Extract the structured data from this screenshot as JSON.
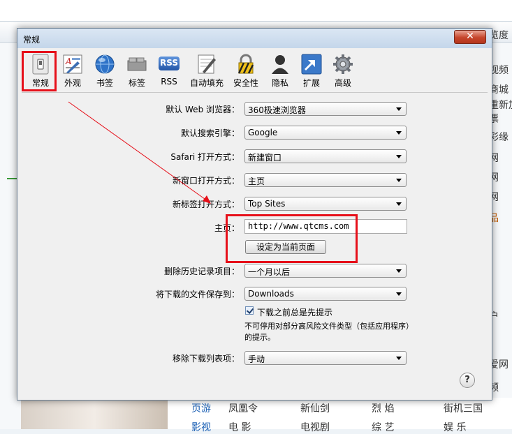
{
  "background": {
    "side_items": [
      "览度",
      "视频",
      "商城",
      "重新加",
      "票",
      "彩缘",
      "网",
      "网",
      "网",
      "品",
      "户",
      "爱网",
      "频"
    ],
    "bottom_links": [
      "页游",
      "凤凰令",
      "新仙剑",
      "烈 焰",
      "街机三国",
      "影视",
      "电 影",
      "电视剧",
      "综 艺",
      "娱 乐"
    ]
  },
  "dialog": {
    "title": "常规",
    "close_label": "✕"
  },
  "toolbar": {
    "items": [
      {
        "label": "常规",
        "icon": "switch-icon"
      },
      {
        "label": "外观",
        "icon": "appearance-icon"
      },
      {
        "label": "书签",
        "icon": "globe-icon"
      },
      {
        "label": "标签",
        "icon": "tabs-icon"
      },
      {
        "label": "RSS",
        "icon": "rss-icon"
      },
      {
        "label": "自动填充",
        "icon": "autofill-icon"
      },
      {
        "label": "安全性",
        "icon": "lock-icon"
      },
      {
        "label": "隐私",
        "icon": "person-icon"
      },
      {
        "label": "扩展",
        "icon": "extensions-icon"
      },
      {
        "label": "高级",
        "icon": "gear-icon"
      }
    ],
    "rss_text": "RSS"
  },
  "form": {
    "default_browser": {
      "label": "默认 Web 浏览器：",
      "value": "360极速浏览器"
    },
    "search_engine": {
      "label": "默认搜索引擎：",
      "value": "Google"
    },
    "safari_open": {
      "label": "Safari 打开方式：",
      "value": "新建窗口"
    },
    "new_window": {
      "label": "新窗口打开方式：",
      "value": "主页"
    },
    "new_tab": {
      "label": "新标签打开方式：",
      "value": "Top Sites"
    },
    "homepage": {
      "label": "主页：",
      "value": "http://www.qtcms.com"
    },
    "set_current": {
      "label": "设定为当前页面"
    },
    "remove_history": {
      "label": "删除历史记录项目：",
      "value": "一个月以后"
    },
    "download_to": {
      "label": "将下载的文件保存到：",
      "value": "Downloads"
    },
    "ask_before_download": {
      "label": "下载之前总是先提示",
      "checked": true
    },
    "note_line1": "不可停用对部分高风险文件类型（包括应用程序）",
    "note_line2": "的提示。",
    "remove_download": {
      "label": "移除下载列表项：",
      "value": "手动"
    },
    "help": "?"
  }
}
